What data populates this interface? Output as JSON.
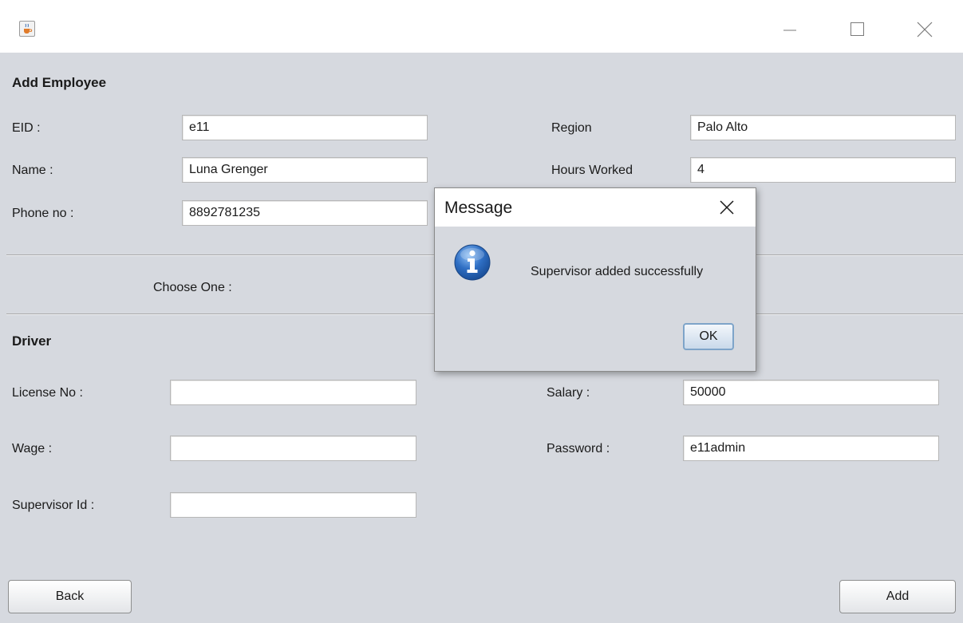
{
  "window": {
    "app_icon": "java-cup-icon",
    "controls": [
      "minimize-icon",
      "maximize-icon",
      "close-icon"
    ]
  },
  "add_employee": {
    "heading": "Add Employee",
    "eid_label": "EID :",
    "eid_value": "e11",
    "name_label": "Name :",
    "name_value": "Luna Grenger",
    "phone_label": "Phone no :",
    "phone_value": "8892781235",
    "region_label": "Region",
    "region_value": "Palo Alto",
    "hours_label": "Hours Worked",
    "hours_value": "4"
  },
  "choose": {
    "label": "Choose One :"
  },
  "driver": {
    "heading": "Driver",
    "license_label": "License No :",
    "license_value": "",
    "wage_label": "Wage :",
    "wage_value": "",
    "supervisor_id_label": "Supervisor Id :",
    "supervisor_id_value": ""
  },
  "supervisor": {
    "salary_label": "Salary :",
    "salary_value": "50000",
    "password_label": "Password :",
    "password_value": "e11admin"
  },
  "buttons": {
    "back": "Back",
    "add": "Add"
  },
  "dialog": {
    "title": "Message",
    "message": "Supervisor added successfully",
    "ok": "OK",
    "icon": "info-icon",
    "icon_color": "#2f6fc4"
  }
}
